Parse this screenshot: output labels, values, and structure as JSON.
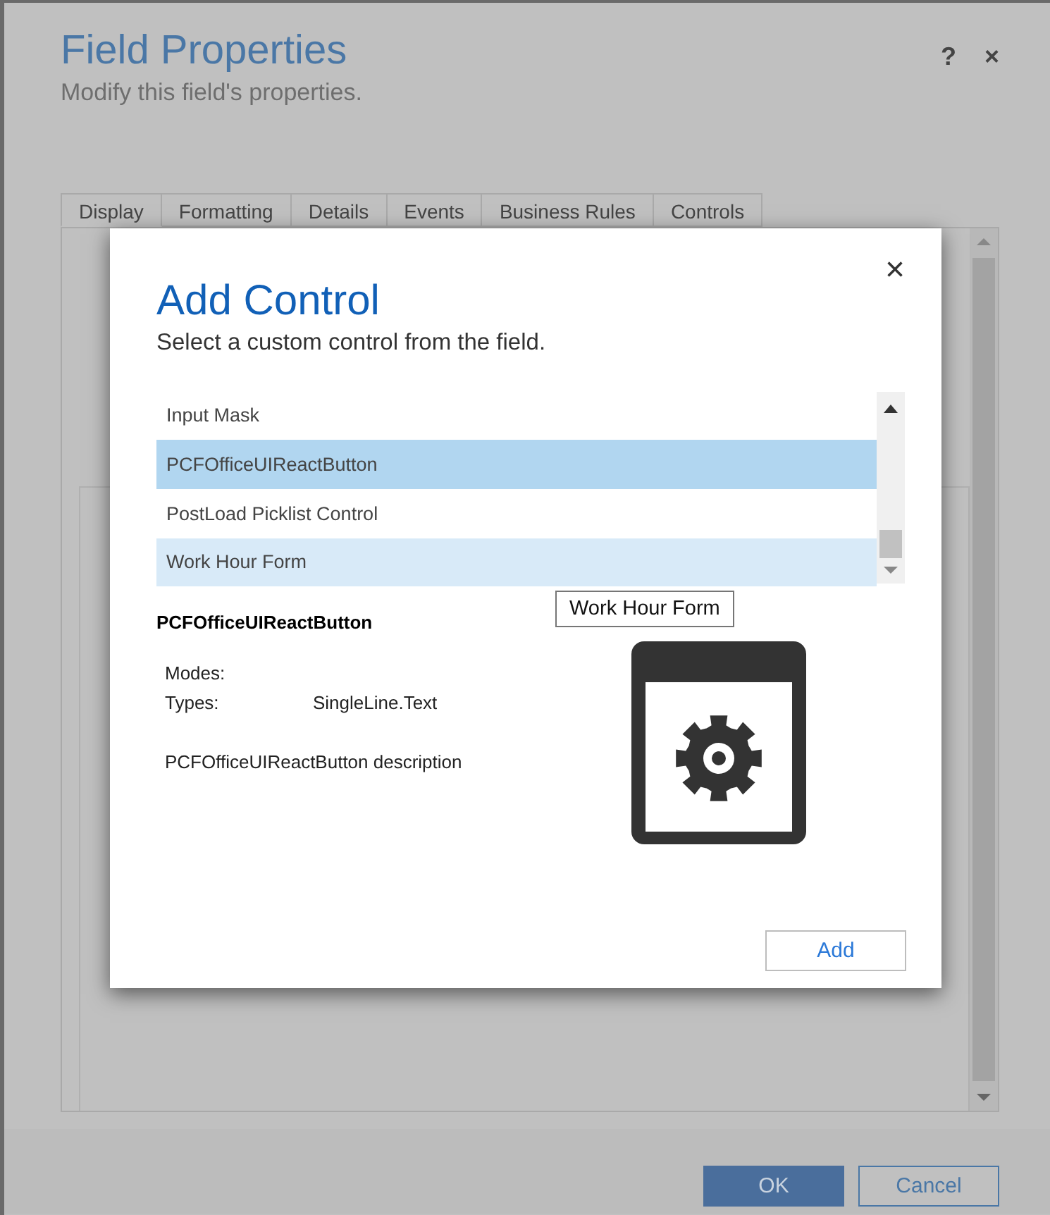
{
  "dialog": {
    "title": "Field Properties",
    "subtitle": "Modify this field's properties.",
    "help": "?",
    "close": "×",
    "tabs": [
      {
        "label": "Display",
        "selected": true
      },
      {
        "label": "Formatting",
        "selected": false
      },
      {
        "label": "Details",
        "selected": false
      },
      {
        "label": "Events",
        "selected": false
      },
      {
        "label": "Business Rules",
        "selected": false
      },
      {
        "label": "Controls",
        "selected": false
      }
    ],
    "buttons": [
      {
        "label": "OK",
        "kind": "primary"
      },
      {
        "label": "Cancel",
        "kind": "secondary"
      }
    ]
  },
  "modal": {
    "title": "Add Control",
    "subtitle": "Select a custom control from the field.",
    "close": "×",
    "controls": [
      {
        "label": "Input Mask",
        "selected": false,
        "hovered": false
      },
      {
        "label": "PCFOfficeUIReactButton",
        "selected": true,
        "hovered": false
      },
      {
        "label": "PostLoad Picklist Control",
        "selected": false,
        "hovered": false
      },
      {
        "label": "Work Hour Form",
        "selected": false,
        "hovered": true
      }
    ],
    "tooltip": "Work Hour Form",
    "details": {
      "name": "PCFOfficeUIReactButton",
      "fields": [
        {
          "label": "Modes:"
        },
        {
          "label": "Types:",
          "value": "SingleLine.Text"
        }
      ],
      "description": "PCFOfficeUIReactButton description"
    },
    "add_button": "Add"
  }
}
